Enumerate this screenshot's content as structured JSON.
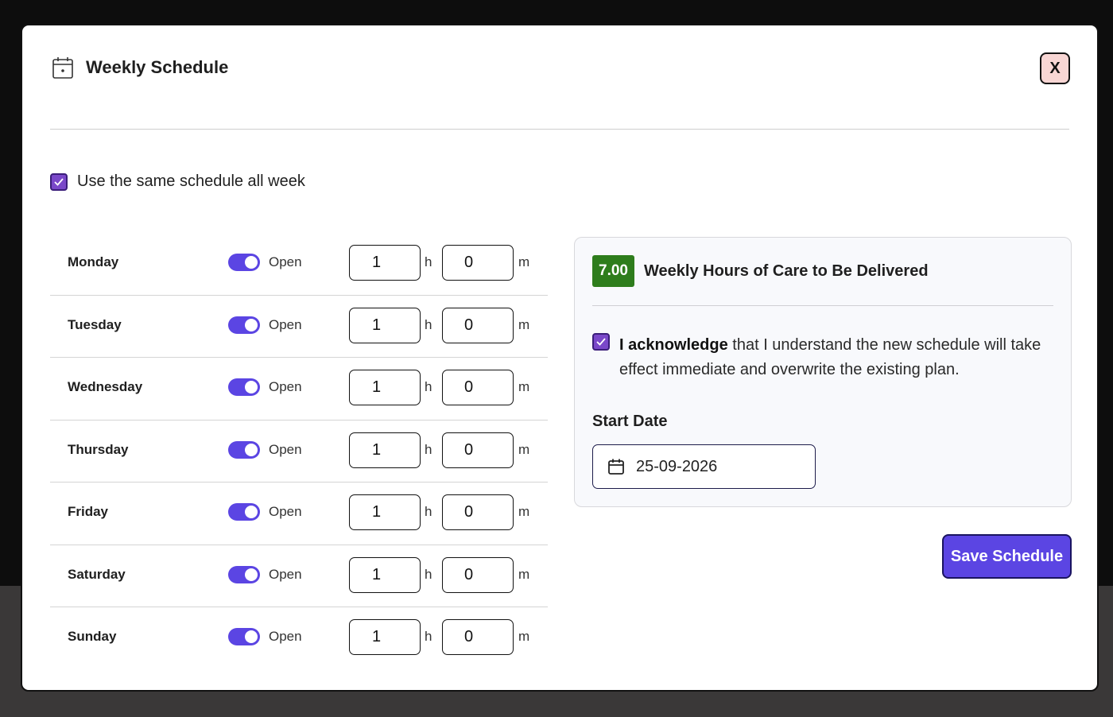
{
  "modal": {
    "title": "Weekly Schedule",
    "close_label": "X",
    "title_icon": "calendar-icon"
  },
  "same_schedule": {
    "label": "Use the same schedule all week",
    "checked": true
  },
  "days": [
    {
      "name": "Monday",
      "status": "Open",
      "hours": "1",
      "hours_unit": "h",
      "minutes": "0",
      "minutes_unit": "m"
    },
    {
      "name": "Tuesday",
      "status": "Open",
      "hours": "1",
      "hours_unit": "h",
      "minutes": "0",
      "minutes_unit": "m"
    },
    {
      "name": "Wednesday",
      "status": "Open",
      "hours": "1",
      "hours_unit": "h",
      "minutes": "0",
      "minutes_unit": "m"
    },
    {
      "name": "Thursday",
      "status": "Open",
      "hours": "1",
      "hours_unit": "h",
      "minutes": "0",
      "minutes_unit": "m"
    },
    {
      "name": "Friday",
      "status": "Open",
      "hours": "1",
      "hours_unit": "h",
      "minutes": "0",
      "minutes_unit": "m"
    },
    {
      "name": "Saturday",
      "status": "Open",
      "hours": "1",
      "hours_unit": "h",
      "minutes": "0",
      "minutes_unit": "m"
    },
    {
      "name": "Sunday",
      "status": "Open",
      "hours": "1",
      "hours_unit": "h",
      "minutes": "0",
      "minutes_unit": "m"
    }
  ],
  "summary": {
    "hours_value": "7.00",
    "hours_label": "Weekly Hours of Care to Be Delivered",
    "ack_bold": "I acknowledge",
    "ack_text": " that I understand the new schedule will take effect immediate and overwrite the existing plan.",
    "ack_checked": true,
    "start_date_label": "Start Date",
    "start_date_value": "25-09-2026"
  },
  "actions": {
    "save_label": "Save Schedule"
  },
  "colors": {
    "accent": "#5b45e3",
    "checkbox": "#7a48c9",
    "badge": "#2e7d1c",
    "close_bg": "#f8d6d4"
  }
}
